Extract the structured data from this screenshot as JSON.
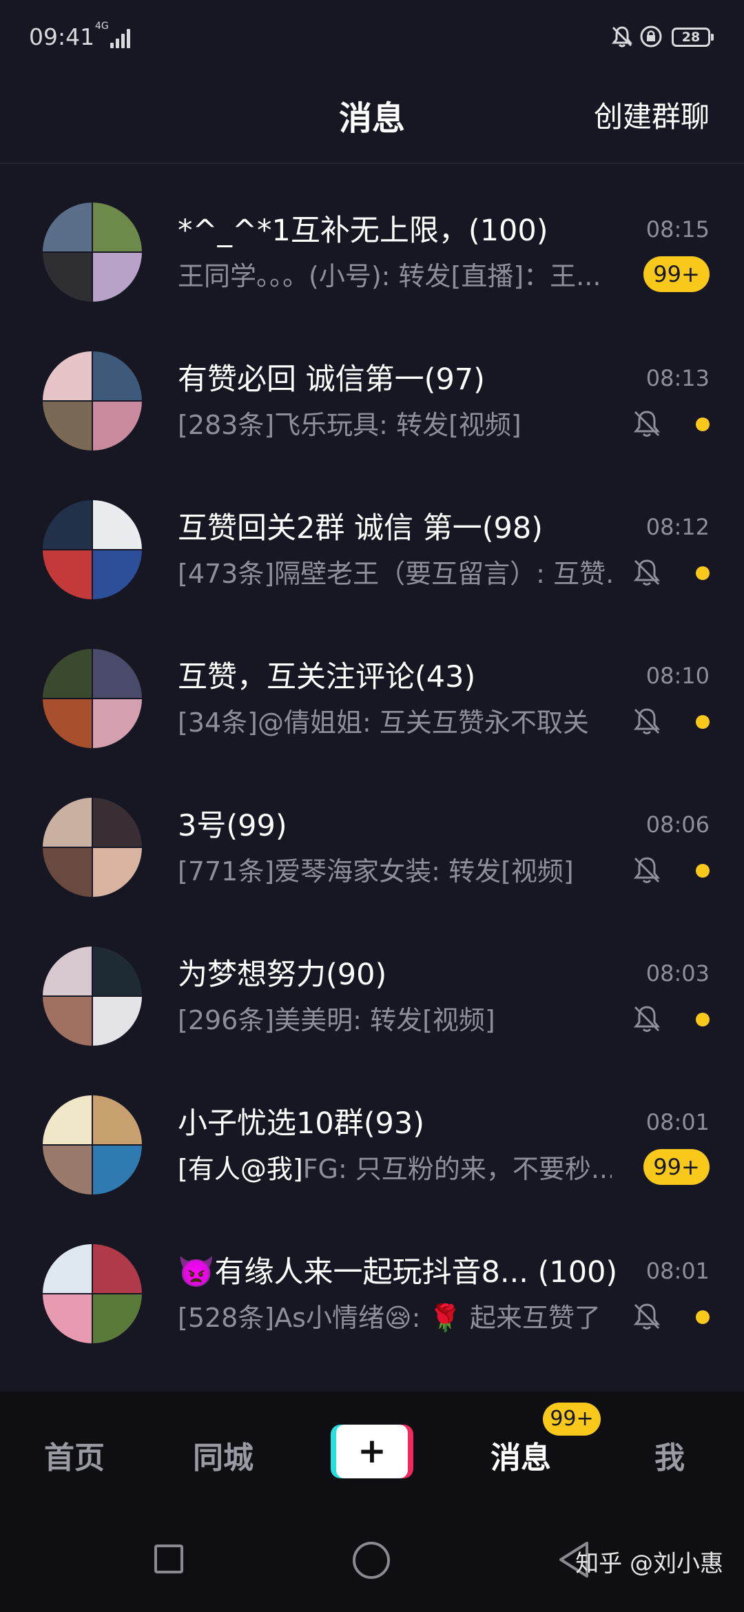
{
  "status_bar": {
    "time": "09:41",
    "network": "4G",
    "battery": "28",
    "icons": [
      "signal-icon",
      "bell-off-icon",
      "rotation-lock-icon",
      "battery-icon"
    ]
  },
  "header": {
    "title": "消息",
    "action": "创建群聊"
  },
  "chats": [
    {
      "name": "*^_^*1互补无上限，(100)",
      "preview_highlight": "",
      "preview": "王同学。。。(小号): 转发[直播]：王...",
      "time": "08:15",
      "badge": "99+",
      "muted": false,
      "avatar_colors": [
        "#5b6f8a",
        "#6d8a4a",
        "#2e2e33",
        "#b8a2c8"
      ]
    },
    {
      "name": "有赞必回 诚信第一(97)",
      "preview_highlight": "",
      "preview": "[283条]飞乐玩具: 转发[视频]",
      "time": "08:13",
      "badge": "",
      "muted": true,
      "avatar_colors": [
        "#e7c4c8",
        "#3e5a7a",
        "#7a6a55",
        "#c98a9e"
      ]
    },
    {
      "name": "互赞回关2群 诚信 第一(98)",
      "preview_highlight": "",
      "preview": "[473条]隔壁老王（要互留言）: 互赞...",
      "time": "08:12",
      "badge": "",
      "muted": true,
      "avatar_colors": [
        "#22304a",
        "#e9edf0",
        "#c43a3a",
        "#2d4f9a"
      ]
    },
    {
      "name": "互赞，互关注评论(43)",
      "preview_highlight": "",
      "preview": "[34条]@倩姐姐: 互关互赞永不取关",
      "time": "08:10",
      "badge": "",
      "muted": true,
      "avatar_colors": [
        "#3b4a2e",
        "#4a4a6a",
        "#a8502e",
        "#d4a0b0"
      ]
    },
    {
      "name": "3号(99)",
      "preview_highlight": "",
      "preview": "[771条]爱琴海家女装: 转发[视频]",
      "time": "08:06",
      "badge": "",
      "muted": true,
      "avatar_colors": [
        "#c9b0a0",
        "#3a2e35",
        "#6a4a40",
        "#d8b4a0"
      ]
    },
    {
      "name": "为梦想努力(90)",
      "preview_highlight": "",
      "preview": "[296条]美美明: 转发[视频]",
      "time": "08:03",
      "badge": "",
      "muted": true,
      "avatar_colors": [
        "#d8c8d0",
        "#1e2a34",
        "#a07060",
        "#e4e4e8"
      ]
    },
    {
      "name": "小子忧选10群(93)",
      "preview_highlight": "[有人@我]",
      "preview": "FG: 只互粉的来，不要秒...",
      "time": "08:01",
      "badge": "99+",
      "muted": false,
      "avatar_colors": [
        "#f0e6c8",
        "#c8a070",
        "#9a7a6a",
        "#2f7ab0"
      ]
    },
    {
      "name": "👿有缘人来一起玩抖音8... (100)",
      "preview_highlight": "",
      "preview": "[528条]As小情绪😪: 🌹 起来互赞了",
      "time": "08:01",
      "badge": "",
      "muted": true,
      "avatar_colors": [
        "#dfe8f0",
        "#b03a4a",
        "#e89ab0",
        "#5a7a3a"
      ]
    }
  ],
  "tabbar": {
    "home": "首页",
    "nearby": "同城",
    "create": "+",
    "messages": "消息",
    "messages_badge": "99+",
    "me": "我"
  },
  "watermark": "知乎 @刘小惠"
}
